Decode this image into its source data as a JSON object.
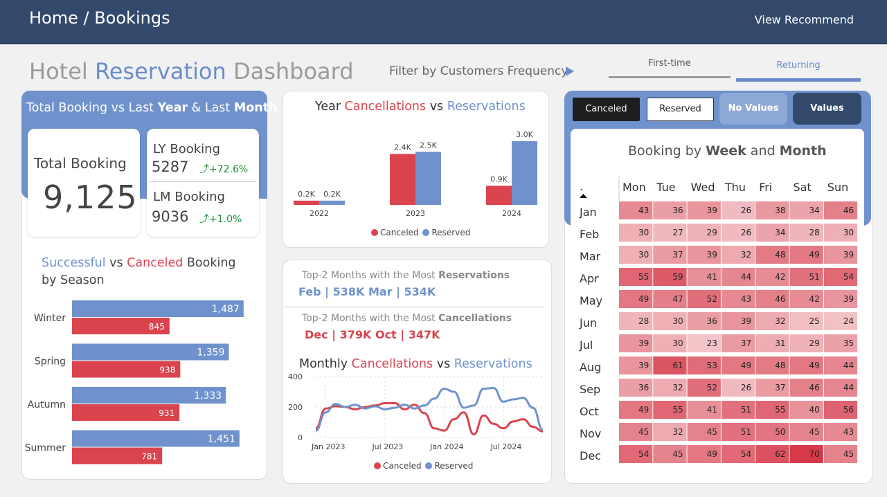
{
  "header": {
    "breadcrumb": "Home / Bookings",
    "view_recommend": "View Recommend"
  },
  "title": {
    "part1": "Hotel",
    "part2": "Reservation",
    "part3": "Dashboard"
  },
  "filter": {
    "label": "Filter by Customers Frequency",
    "options": [
      "First-time",
      "Returning"
    ],
    "selected": "Returning"
  },
  "kpi": {
    "heading_parts": [
      "Total Booking vs Last ",
      "Year",
      " & Last ",
      "Month"
    ],
    "total_label": "Total Booking",
    "total_value": "9,125",
    "ly_label": "LY Booking",
    "ly_value": "5287",
    "ly_change": "+72.6%",
    "lm_label": "LM Booking",
    "lm_value": "9036",
    "lm_change": "+1.0%"
  },
  "colors": {
    "canceled": "#d9444f",
    "reserved": "#6f92cc",
    "navy": "#33496c"
  },
  "season_chart": {
    "title_parts": [
      "Successful",
      " vs ",
      "Canceled",
      " Booking"
    ],
    "title_line2": "by Season",
    "chart_data": {
      "type": "bar",
      "categories": [
        "Winter",
        "Spring",
        "Autumn",
        "Summer"
      ],
      "series": [
        {
          "name": "Successful",
          "values": [
            1487,
            1359,
            1333,
            1451
          ]
        },
        {
          "name": "Canceled",
          "values": [
            845,
            938,
            931,
            781
          ]
        }
      ],
      "value_labels": {
        "Successful": [
          "1,487",
          "1,359",
          "1,333",
          "1,451"
        ],
        "Canceled": [
          "845",
          "938",
          "931",
          "781"
        ]
      }
    }
  },
  "year_chart": {
    "title_parts": [
      "Year ",
      "Cancellations",
      " vs ",
      "Reservations"
    ],
    "chart_data": {
      "type": "bar",
      "categories": [
        "2022",
        "2023",
        "2024"
      ],
      "series": [
        {
          "name": "Canceled",
          "values": [
            0.2,
            2.4,
            0.9
          ],
          "labels": [
            "0.2K",
            "2.4K",
            "0.9K"
          ]
        },
        {
          "name": "Reserved",
          "values": [
            0.2,
            2.5,
            3.0
          ],
          "labels": [
            "0.2K",
            "2.5K",
            "3.0K"
          ]
        }
      ]
    },
    "legend": [
      "Canceled",
      "Reserved"
    ]
  },
  "top_months": {
    "res_label_prefix": "Top-2 Months with the Most ",
    "res_label_bold": "Reservations",
    "res_value": "Feb | 538K Mar | 534K",
    "can_label_prefix": "Top-2 Months with the Most ",
    "can_label_bold": "Cancellations",
    "can_value": "Dec | 379K Oct | 347K"
  },
  "monthly_chart": {
    "title_parts": [
      "Monthly ",
      "Cancellations",
      " vs ",
      "Reservations"
    ],
    "chart_data": {
      "type": "line",
      "x_ticks": [
        "Jan 2023",
        "Jul 2023",
        "Jan 2024",
        "Jul 2024"
      ],
      "y_ticks": [
        "0",
        "200",
        "400"
      ],
      "ylim": [
        0,
        400
      ],
      "series": [
        {
          "name": "Canceled",
          "values": [
            60,
            190,
            205,
            200,
            185,
            200,
            210,
            225,
            225,
            185,
            215,
            160,
            60,
            45,
            120,
            165,
            20,
            145,
            90,
            60,
            105,
            120,
            70,
            40
          ]
        },
        {
          "name": "Reserved",
          "values": [
            45,
            165,
            220,
            200,
            215,
            190,
            205,
            185,
            195,
            215,
            190,
            210,
            255,
            320,
            300,
            195,
            210,
            320,
            325,
            235,
            250,
            260,
            195,
            50
          ]
        }
      ]
    },
    "legend": [
      "Canceled",
      "Reserved"
    ]
  },
  "heatmap": {
    "buttons": [
      "Canceled",
      "Reserved",
      "No Values",
      "Values"
    ],
    "title_parts": [
      "Booking by ",
      "Week",
      " and ",
      "Month"
    ],
    "corner_label": ".",
    "chart_data": {
      "type": "heatmap",
      "columns": [
        "Mon",
        "Tue",
        "Wed",
        "Thu",
        "Fri",
        "Sat",
        "Sun"
      ],
      "rows": [
        "Jan",
        "Feb",
        "Mar",
        "Apr",
        "May",
        "Jun",
        "Jul",
        "Aug",
        "Sep",
        "Oct",
        "Nov",
        "Dec"
      ],
      "values": [
        [
          43,
          36,
          39,
          26,
          38,
          34,
          46
        ],
        [
          30,
          27,
          29,
          26,
          34,
          28,
          30
        ],
        [
          30,
          37,
          39,
          32,
          48,
          49,
          39
        ],
        [
          55,
          59,
          41,
          44,
          42,
          51,
          54
        ],
        [
          49,
          47,
          52,
          43,
          46,
          42,
          39
        ],
        [
          28,
          30,
          36,
          39,
          32,
          25,
          24
        ],
        [
          39,
          30,
          23,
          37,
          31,
          29,
          35
        ],
        [
          39,
          61,
          53,
          49,
          48,
          49,
          44
        ],
        [
          36,
          32,
          52,
          26,
          37,
          46,
          44
        ],
        [
          49,
          55,
          41,
          51,
          55,
          40,
          56
        ],
        [
          45,
          32,
          45,
          51,
          50,
          45,
          43
        ],
        [
          54,
          45,
          49,
          54,
          62,
          70,
          45
        ]
      ]
    }
  }
}
